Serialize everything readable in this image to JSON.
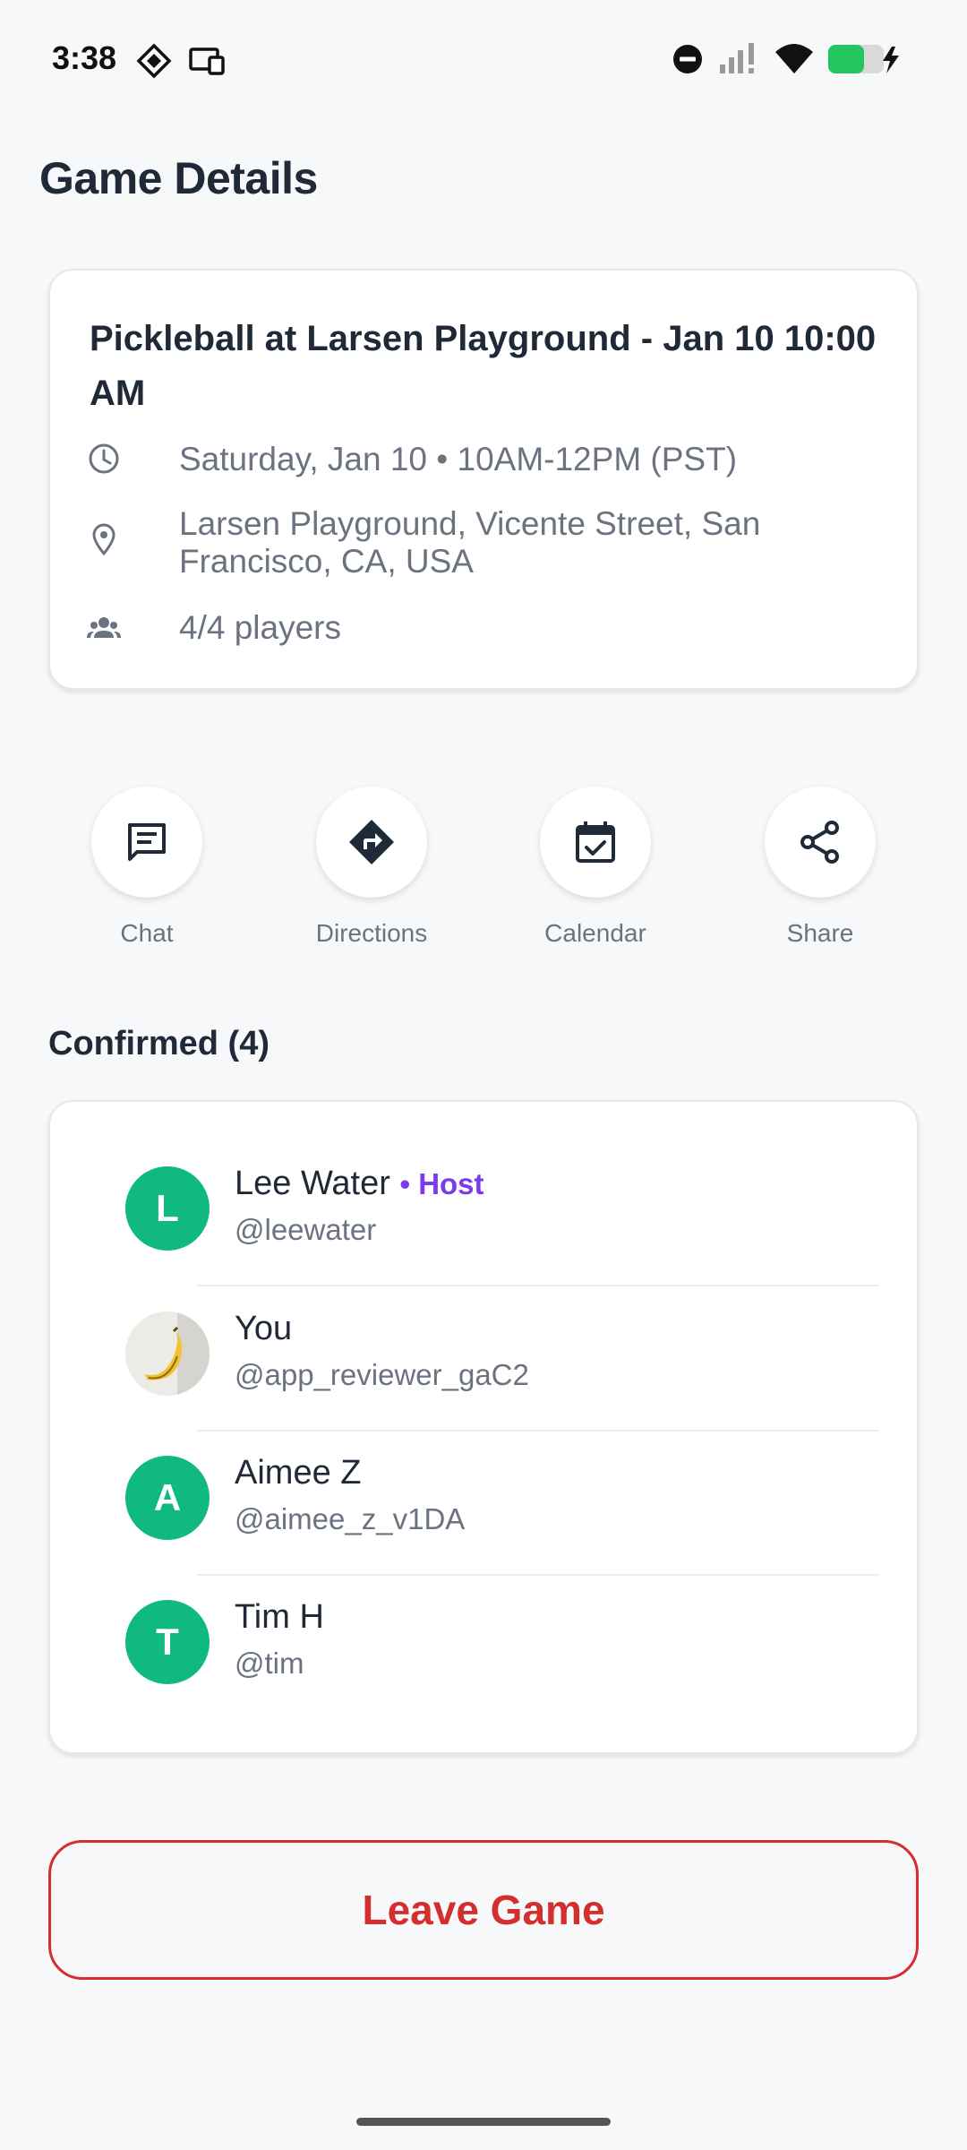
{
  "status_bar": {
    "time": "3:38"
  },
  "header": {
    "title": "Game Details"
  },
  "game": {
    "title": "Pickleball at Larsen Playground - Jan 10 10:00 AM",
    "datetime": "Saturday, Jan 10 • 10AM-12PM (PST)",
    "location": "Larsen Playground, Vicente Street, San Francisco, CA, USA",
    "players": "4/4 players"
  },
  "actions": [
    {
      "label": "Chat",
      "icon": "chat-icon"
    },
    {
      "label": "Directions",
      "icon": "directions-icon"
    },
    {
      "label": "Calendar",
      "icon": "calendar-icon"
    },
    {
      "label": "Share",
      "icon": "share-icon"
    }
  ],
  "confirmed": {
    "heading": "Confirmed (4)",
    "players": [
      {
        "initial": "L",
        "name": "Lee Water",
        "host_label": "• Host",
        "handle": "@leewater"
      },
      {
        "initial": "",
        "name": "You",
        "handle": "@app_reviewer_gaC2",
        "avatar": "banana-photo"
      },
      {
        "initial": "A",
        "name": "Aimee Z",
        "handle": "@aimee_z_v1DA"
      },
      {
        "initial": "T",
        "name": "Tim H",
        "handle": "@tim"
      }
    ]
  },
  "leave_button": {
    "label": "Leave Game"
  },
  "colors": {
    "accent_green": "#10b981",
    "host_purple": "#7c3aed",
    "danger_red": "#d32f2f",
    "text_dark": "#1f2937",
    "text_muted": "#6b7280"
  }
}
